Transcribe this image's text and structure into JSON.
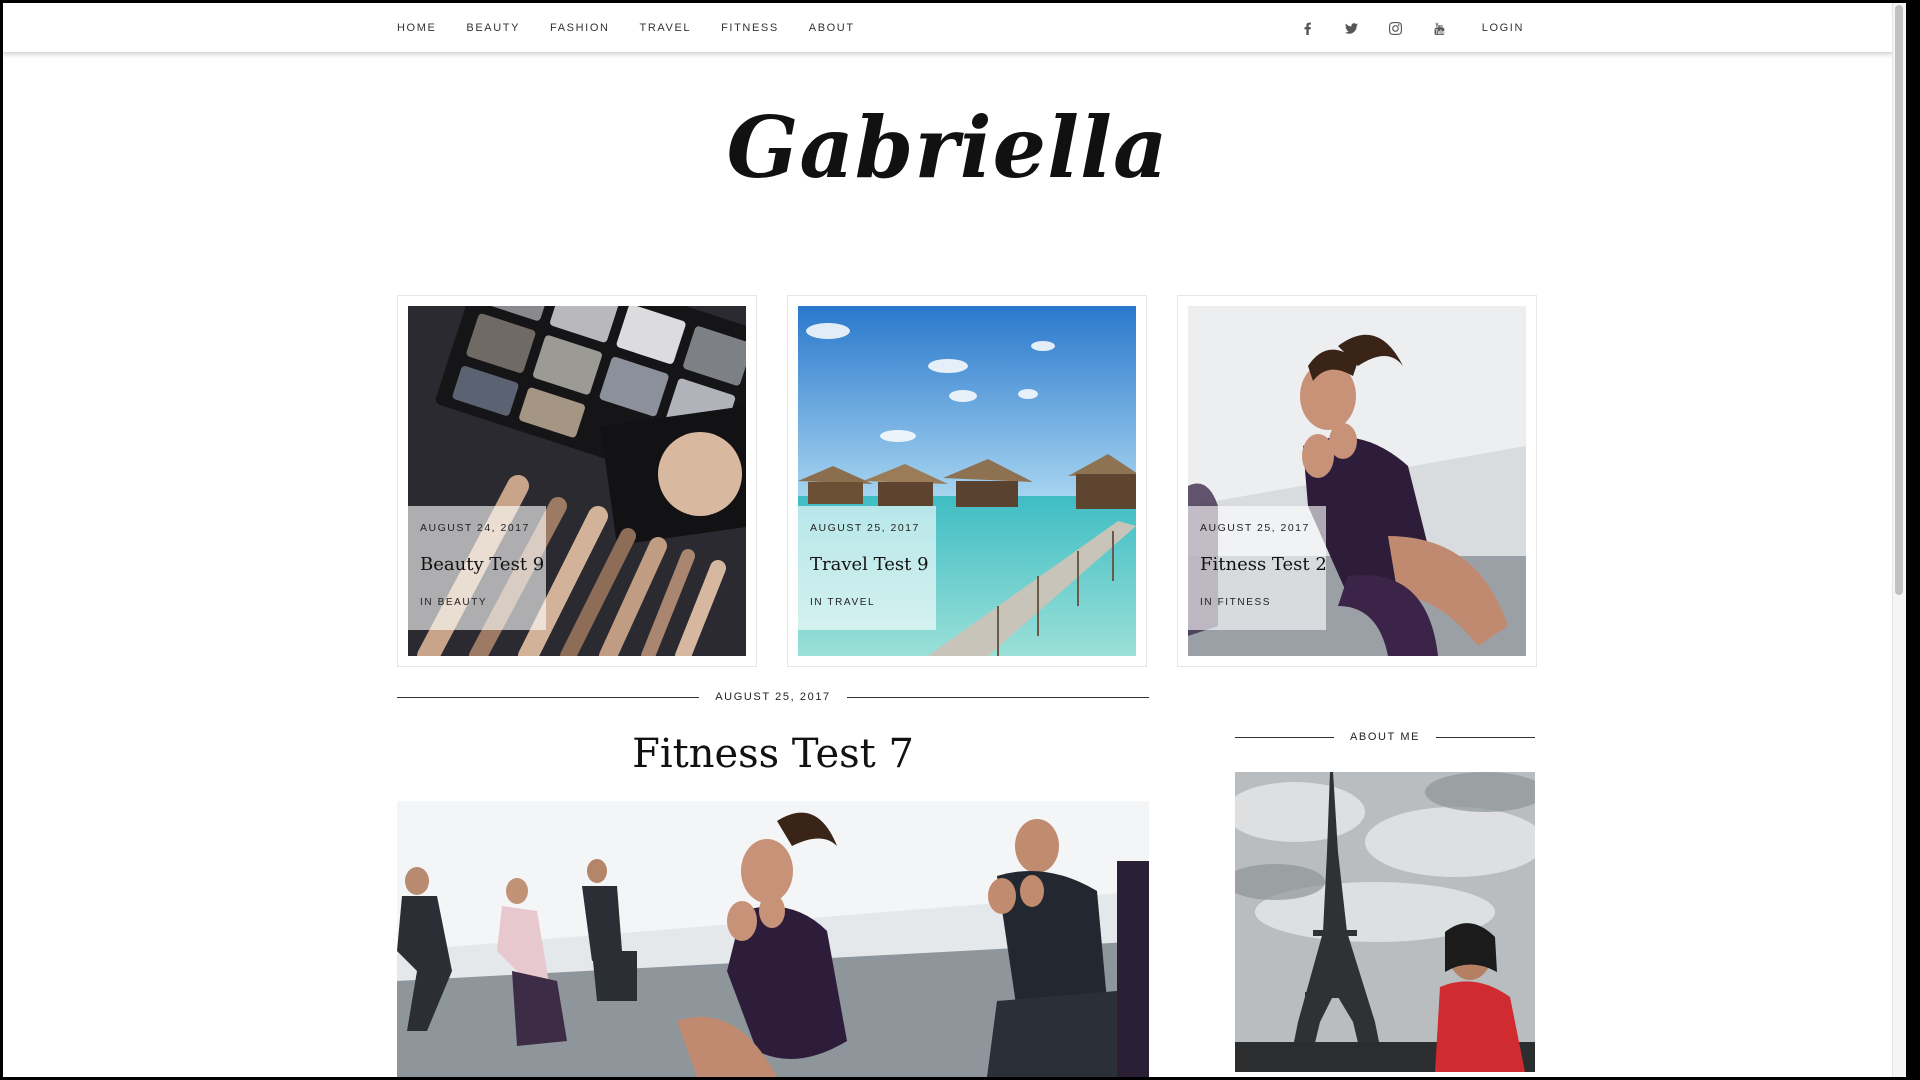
{
  "nav": {
    "items": [
      "HOME",
      "BEAUTY",
      "FASHION",
      "TRAVEL",
      "FITNESS",
      "ABOUT"
    ],
    "social": [
      "facebook-icon",
      "twitter-icon",
      "instagram-icon",
      "youtube-icon"
    ],
    "login": "LOGIN"
  },
  "site": {
    "logo": "Gabriella"
  },
  "featured": [
    {
      "date": "AUGUST 24, 2017",
      "title": "Beauty Test 9",
      "category": "IN BEAUTY"
    },
    {
      "date": "AUGUST 25, 2017",
      "title": "Travel Test 9",
      "category": "IN TRAVEL"
    },
    {
      "date": "AUGUST 25, 2017",
      "title": "Fitness Test 2",
      "category": "IN FITNESS"
    }
  ],
  "post": {
    "date": "AUGUST 25, 2017",
    "title": "Fitness Test 7"
  },
  "sidebar": {
    "about_title": "ABOUT ME"
  },
  "colors": {
    "text": "#222222",
    "rule": "#333333",
    "border": "#e6e6e6"
  }
}
